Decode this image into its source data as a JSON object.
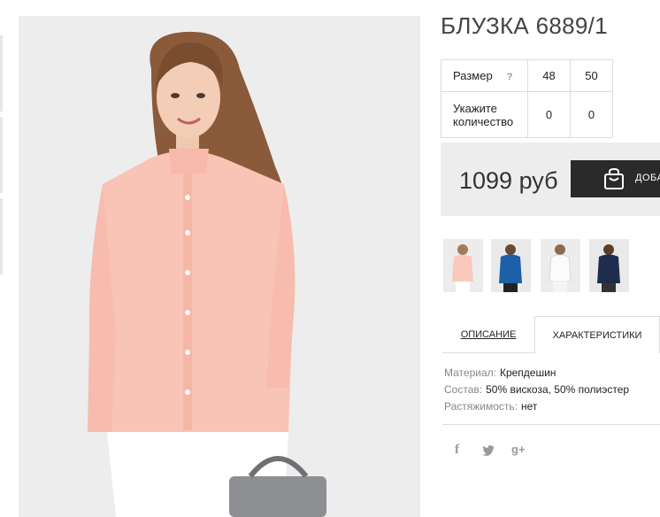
{
  "product": {
    "title": "БЛУЗКА 6889/1"
  },
  "size_table": {
    "size_label": "Размер",
    "help_icon": "?",
    "qty_label_line1": "Укажите",
    "qty_label_line2": "количество",
    "sizes": [
      "48",
      "50"
    ],
    "quantities": [
      "0",
      "0"
    ]
  },
  "purchase": {
    "price": "1099 руб",
    "add_button_label": "ДОБАВИТЬ",
    "add_button_icon": "shopping-bag-icon"
  },
  "thumbnails": [
    {
      "name": "pink-blouse"
    },
    {
      "name": "blue-blouse"
    },
    {
      "name": "white-blouse"
    },
    {
      "name": "navy-blouse"
    }
  ],
  "tabs": [
    {
      "label": "ОПИСАНИЕ"
    },
    {
      "label": "ХАРАКТЕРИСТИКИ"
    }
  ],
  "specs": [
    {
      "key": "Материал:",
      "value": "Крепдешин"
    },
    {
      "key": "Состав:",
      "value": "50% вискоза, 50% полиэстер"
    },
    {
      "key": "Растяжимость:",
      "value": "нет"
    }
  ],
  "social": {
    "facebook": "f",
    "twitter": "twitter-icon",
    "google_plus": "g+"
  },
  "colors": {
    "button_bg": "#2a2a2a",
    "price_box_bg": "#ededed",
    "blouse": "#f9c4b6"
  }
}
